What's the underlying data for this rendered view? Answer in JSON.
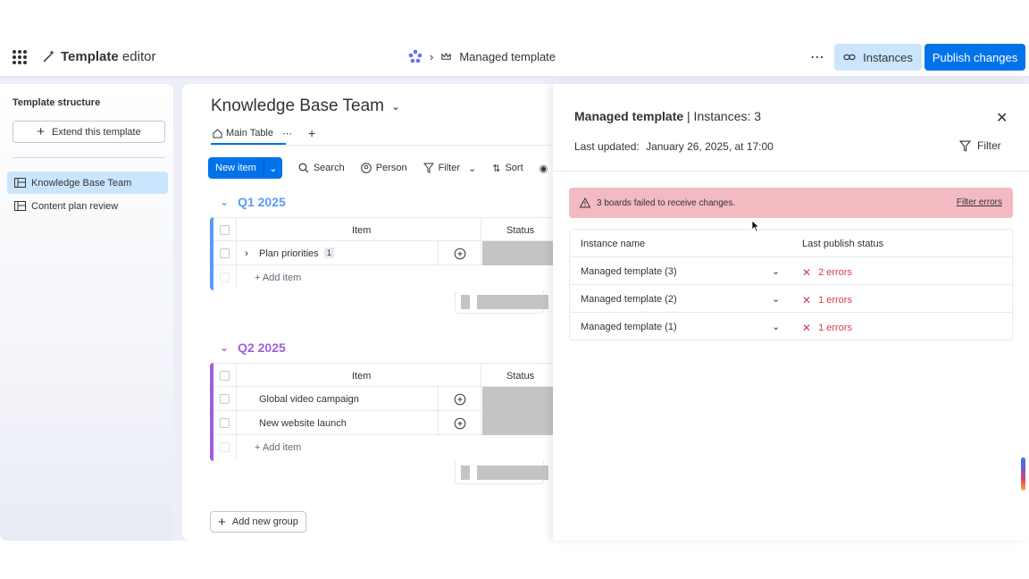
{
  "topbar": {
    "app_title_bold": "Template",
    "app_title_rest": "editor",
    "breadcrumb_current": "Managed template",
    "instances_label": "Instances",
    "publish_label": "Publish changes"
  },
  "sidebar": {
    "title": "Template structure",
    "extend_label": "Extend this template",
    "items": [
      {
        "label": "Knowledge Base Team",
        "active": true
      },
      {
        "label": "Content plan review",
        "active": false
      }
    ]
  },
  "board": {
    "title": "Knowledge Base Team",
    "tab_main": "Main Table",
    "toolbar": {
      "new_item": "New item",
      "search": "Search",
      "person": "Person",
      "filter": "Filter",
      "sort": "Sort"
    },
    "groups": [
      {
        "title": "Q1 2025",
        "color": "#579bfc",
        "header_item": "Item",
        "header_status": "Status",
        "rows": [
          {
            "name": "Plan priorities",
            "subitems": "1"
          }
        ],
        "add_item": "+ Add item"
      },
      {
        "title": "Q2 2025",
        "color": "#a25ddc",
        "header_item": "Item",
        "header_status": "Status",
        "rows": [
          {
            "name": "Global video campaign"
          },
          {
            "name": "New website launch"
          }
        ],
        "add_item": "+ Add item"
      }
    ],
    "add_group": "Add new group"
  },
  "panel": {
    "title_bold": "Managed template",
    "title_rest": " | Instances: 3",
    "last_updated_label": "Last updated:",
    "last_updated_value": "January 26, 2025, at 17:00",
    "filter_label": "Filter",
    "alert_text": "3 boards failed to receive changes.",
    "alert_link": "Filter errors",
    "table_headers": [
      "Instance name",
      "Last publish status"
    ],
    "instances": [
      {
        "name": "Managed template (3)",
        "status": "2 errors"
      },
      {
        "name": "Managed template (2)",
        "status": "1 errors"
      },
      {
        "name": "Managed template (1)",
        "status": "1 errors"
      }
    ]
  }
}
